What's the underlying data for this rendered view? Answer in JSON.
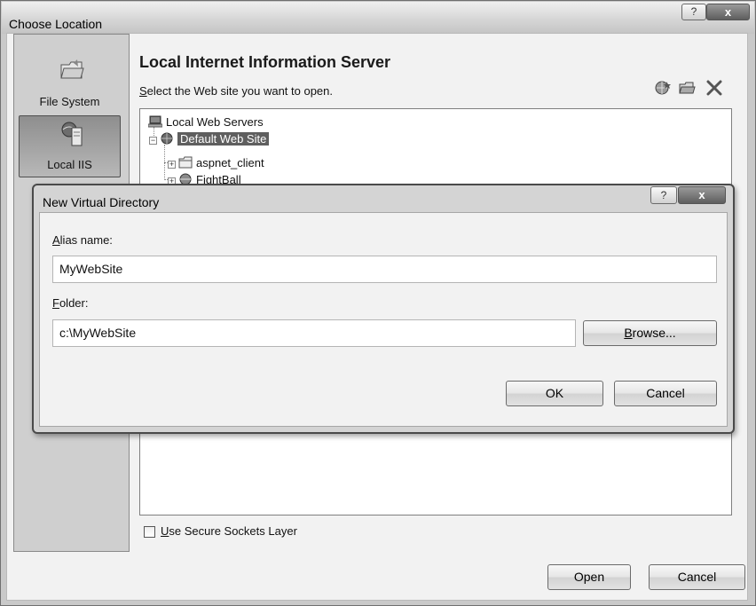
{
  "outer_dialog": {
    "title": "Choose Location",
    "help_glyph": "?",
    "close_glyph": "x",
    "nav": [
      {
        "label": "File System",
        "icon": "folder-icon"
      },
      {
        "label": "Local IIS",
        "icon": "iis-server-icon"
      }
    ],
    "heading": "Local Internet Information Server",
    "subheading": {
      "underlined": "S",
      "rest": "elect the Web site you want to open."
    },
    "toolbar_icons": [
      "new-web-application-icon",
      "new-virtual-directory-icon",
      "delete-icon"
    ],
    "tree": {
      "root": "Local Web Servers",
      "default_site": "Default Web Site",
      "children": [
        "aspnet_client",
        "FightBall"
      ]
    },
    "ssl_checkbox": {
      "underlined": "U",
      "rest": "se Secure Sockets Layer",
      "checked": false
    },
    "open_label": "Open",
    "cancel_label": "Cancel"
  },
  "inner_dialog": {
    "title": "New Virtual Directory",
    "help_glyph": "?",
    "close_glyph": "x",
    "alias": {
      "label_underlined": "A",
      "label_rest": "lias name:",
      "value": "MyWebSite"
    },
    "folder": {
      "label_underlined": "F",
      "label_rest": "older:",
      "value": "c:\\MyWebSite"
    },
    "browse": {
      "underlined": "B",
      "rest": "rowse..."
    },
    "ok_label": "OK",
    "cancel_label": "Cancel"
  }
}
